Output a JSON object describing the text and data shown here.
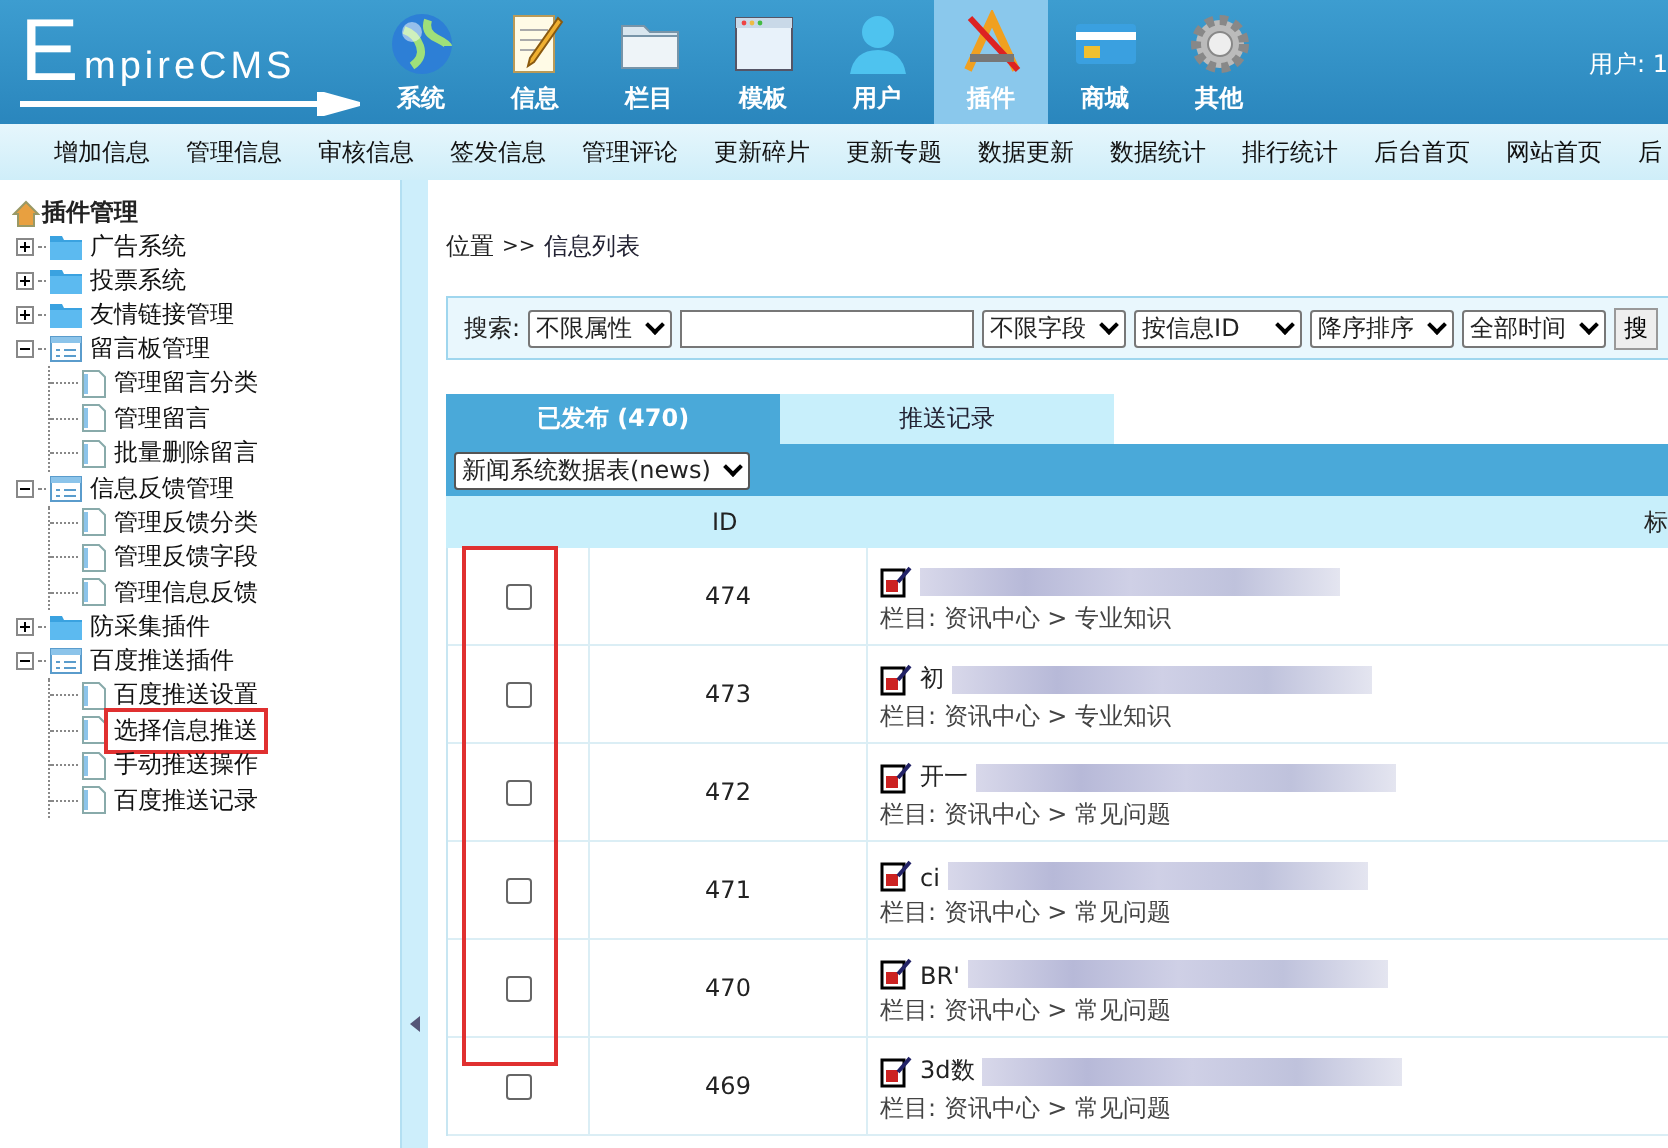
{
  "header": {
    "logo": {
      "big_letter": "E",
      "rest": "mpireCMS"
    },
    "nav": [
      {
        "label": "系统",
        "selected": false
      },
      {
        "label": "信息",
        "selected": false
      },
      {
        "label": "栏目",
        "selected": false
      },
      {
        "label": "模板",
        "selected": false
      },
      {
        "label": "用户",
        "selected": false
      },
      {
        "label": "插件",
        "selected": true
      },
      {
        "label": "商城",
        "selected": false
      },
      {
        "label": "其他",
        "selected": false
      }
    ],
    "user": "用户: 1"
  },
  "menu": [
    "增加信息",
    "管理信息",
    "审核信息",
    "签发信息",
    "管理评论",
    "更新碎片",
    "更新专题",
    "数据更新",
    "数据统计",
    "排行统计",
    "后台首页",
    "网站首页",
    "后"
  ],
  "sidebar": {
    "title": "插件管理",
    "items": [
      {
        "label": "广告系统",
        "expanded": false
      },
      {
        "label": "投票系统",
        "expanded": false
      },
      {
        "label": "友情链接管理",
        "expanded": false
      },
      {
        "label": "留言板管理",
        "expanded": true,
        "children": [
          {
            "label": "管理留言分类",
            "marked": false
          },
          {
            "label": "管理留言",
            "marked": false
          },
          {
            "label": "批量删除留言",
            "marked": false
          }
        ]
      },
      {
        "label": "信息反馈管理",
        "expanded": true,
        "children": [
          {
            "label": "管理反馈分类",
            "marked": false
          },
          {
            "label": "管理反馈字段",
            "marked": false
          },
          {
            "label": "管理信息反馈",
            "marked": false
          }
        ]
      },
      {
        "label": "防采集插件",
        "expanded": false
      },
      {
        "label": "百度推送插件",
        "expanded": true,
        "children": [
          {
            "label": "百度推送设置",
            "marked": false
          },
          {
            "label": "选择信息推送",
            "marked": true
          },
          {
            "label": "手动推送操作",
            "marked": false
          },
          {
            "label": "百度推送记录",
            "marked": false
          }
        ]
      }
    ]
  },
  "breadcrumb": {
    "label": "位置",
    "sep": ">>",
    "current": "信息列表"
  },
  "search": {
    "label": "搜索:",
    "selects": [
      "不限属性",
      "不限字段",
      "按信息ID",
      "降序排序",
      "全部时间"
    ],
    "button": "搜"
  },
  "tabs": [
    {
      "label": "已发布 (470)",
      "selected": true
    },
    {
      "label": "推送记录",
      "selected": false
    }
  ],
  "table": {
    "table_select": "新闻系统数据表(news)",
    "columns": [
      "ID",
      "标"
    ],
    "rows": [
      {
        "checked": false,
        "id": "474",
        "title": "",
        "category": "栏目: 资讯中心 > 专业知识"
      },
      {
        "checked": false,
        "id": "473",
        "title": "初",
        "category": "栏目: 资讯中心 > 专业知识"
      },
      {
        "checked": false,
        "id": "472",
        "title": "开一",
        "category": "栏目: 资讯中心 > 常见问题"
      },
      {
        "checked": false,
        "id": "471",
        "title": "ci",
        "category": "栏目: 资讯中心 > 常见问题"
      },
      {
        "checked": false,
        "id": "470",
        "title": "BR'",
        "category": "栏目: 资讯中心 > 常见问题"
      },
      {
        "checked": false,
        "id": "469",
        "title": "3d数",
        "category": "栏目: 资讯中心 > 常见问题"
      }
    ]
  }
}
